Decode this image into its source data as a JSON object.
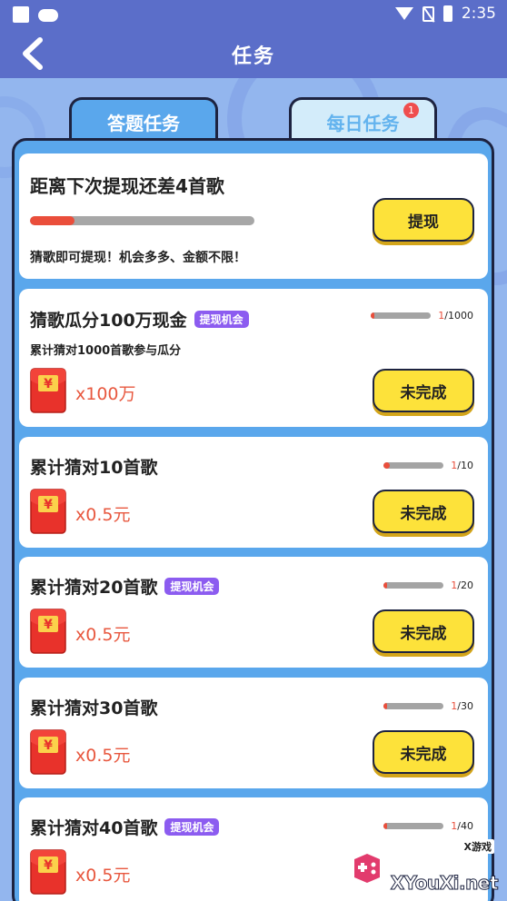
{
  "status_bar": {
    "time": "2:35"
  },
  "header": {
    "title": "任务"
  },
  "tabs": [
    {
      "label": "答题任务",
      "active": false
    },
    {
      "label": "每日任务",
      "active": true,
      "badge": "1"
    }
  ],
  "cash_card": {
    "title": "距离下次提现还差4首歌",
    "progress": 0.2,
    "button_label": "提现",
    "hint": "猜歌即可提现！机会多多、金额不限！"
  },
  "tasks": [
    {
      "title": "猜歌瓜分100万现金",
      "badge": "提现机会",
      "subtitle": "累计猜对1000首歌参与瓜分",
      "progress_current": "1",
      "progress_total": "/1000",
      "reward": "x100万",
      "button_label": "未完成"
    },
    {
      "title": "累计猜对10首歌",
      "badge": "",
      "progress_current": "1",
      "progress_total": "/10",
      "reward": "x0.5元",
      "button_label": "未完成"
    },
    {
      "title": "累计猜对20首歌",
      "badge": "提现机会",
      "progress_current": "1",
      "progress_total": "/20",
      "reward": "x0.5元",
      "button_label": "未完成"
    },
    {
      "title": "累计猜对30首歌",
      "badge": "",
      "progress_current": "1",
      "progress_total": "/30",
      "reward": "x0.5元",
      "button_label": "未完成"
    },
    {
      "title": "累计猜对40首歌",
      "badge": "提现机会",
      "progress_current": "1",
      "progress_total": "/40",
      "reward": "x0.5元"
    }
  ],
  "watermark": {
    "top": "X游戏",
    "main": "XYouXi.net"
  },
  "colors": {
    "header": "#5b6ec9",
    "panel": "#5aa7ec",
    "button": "#fde23a",
    "badge": "#8c5cf0",
    "reward": "#e8583f",
    "progress_fill": "#ea4e3b"
  }
}
